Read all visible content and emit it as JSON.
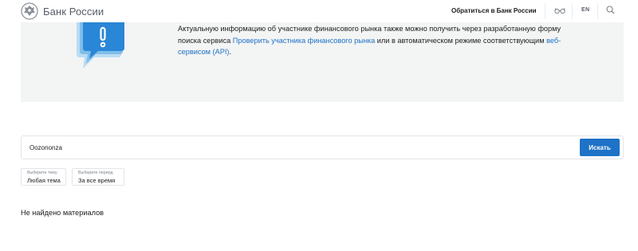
{
  "header": {
    "logo_text": "Банк России",
    "contact_link": "Обратиться в Банк России",
    "language": "EN"
  },
  "info": {
    "text_part1": "Актуальную информацию об участнике финансового рынка также можно получить через разработанную форму поиска сервиса ",
    "link1": "Проверить участника финансового рынка",
    "text_part2": " или в автоматическом режиме соответствующим ",
    "link2": "веб-сервисом (API)",
    "text_part3": "."
  },
  "search": {
    "value": "Oozononza",
    "button_label": "Искать"
  },
  "filters": {
    "topic": {
      "label": "Выберите тему",
      "value": "Любая тема"
    },
    "period": {
      "label": "Выберите период",
      "value": "За все время"
    }
  },
  "results": {
    "empty_text": "Не найдено материалов"
  },
  "colors": {
    "accent": "#1e72c7",
    "banner_bg": "#f3f4f4",
    "border": "#e3e5e8"
  }
}
